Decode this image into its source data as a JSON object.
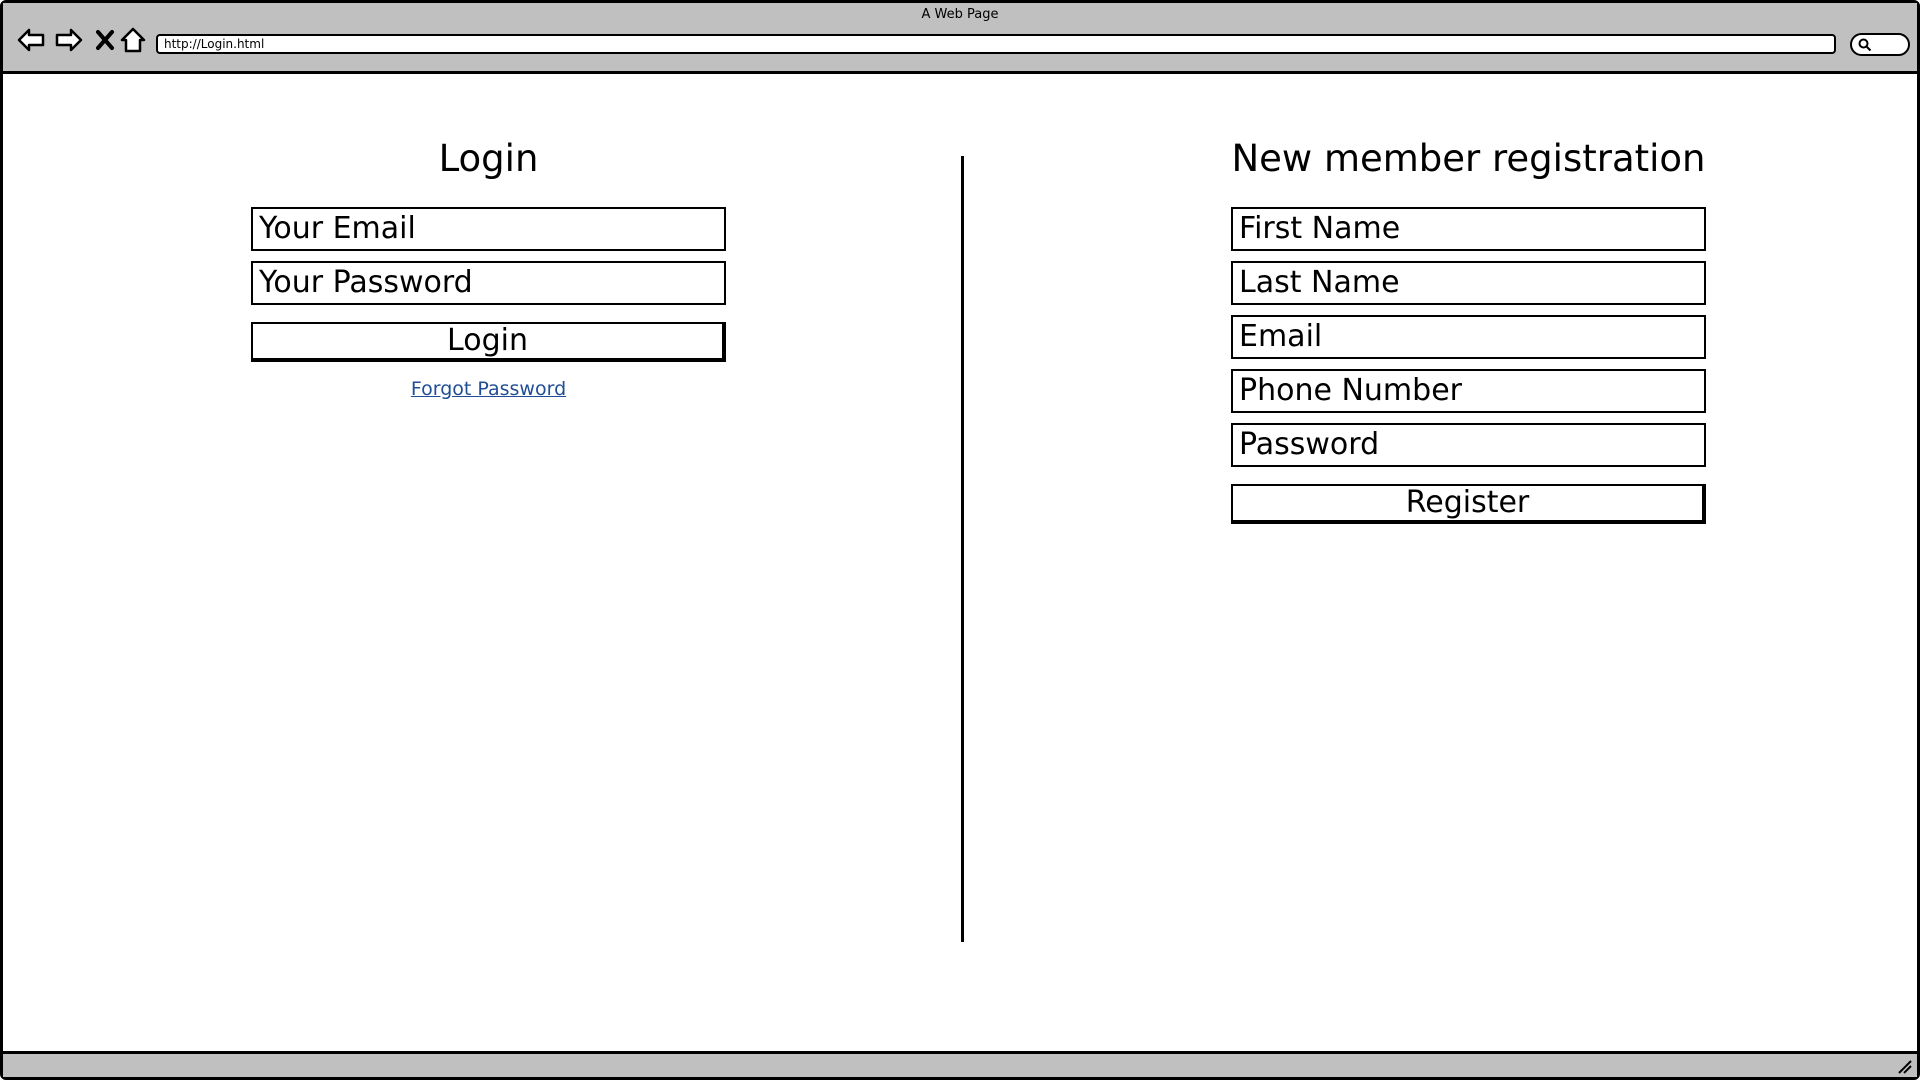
{
  "browser": {
    "window_title": "A Web Page",
    "url": "http://Login.html"
  },
  "login": {
    "title": "Login",
    "email_placeholder": "Your Email",
    "password_placeholder": "Your Password",
    "button_label": "Login",
    "forgot_link": "Forgot Password"
  },
  "registration": {
    "title": "New member registration",
    "first_name_placeholder": "First Name",
    "last_name_placeholder": "Last Name",
    "email_placeholder": "Email",
    "phone_placeholder": "Phone Number",
    "password_placeholder": "Password",
    "button_label": "Register"
  },
  "colors": {
    "chrome": "#c0c0c0",
    "link": "#1f4e96"
  }
}
